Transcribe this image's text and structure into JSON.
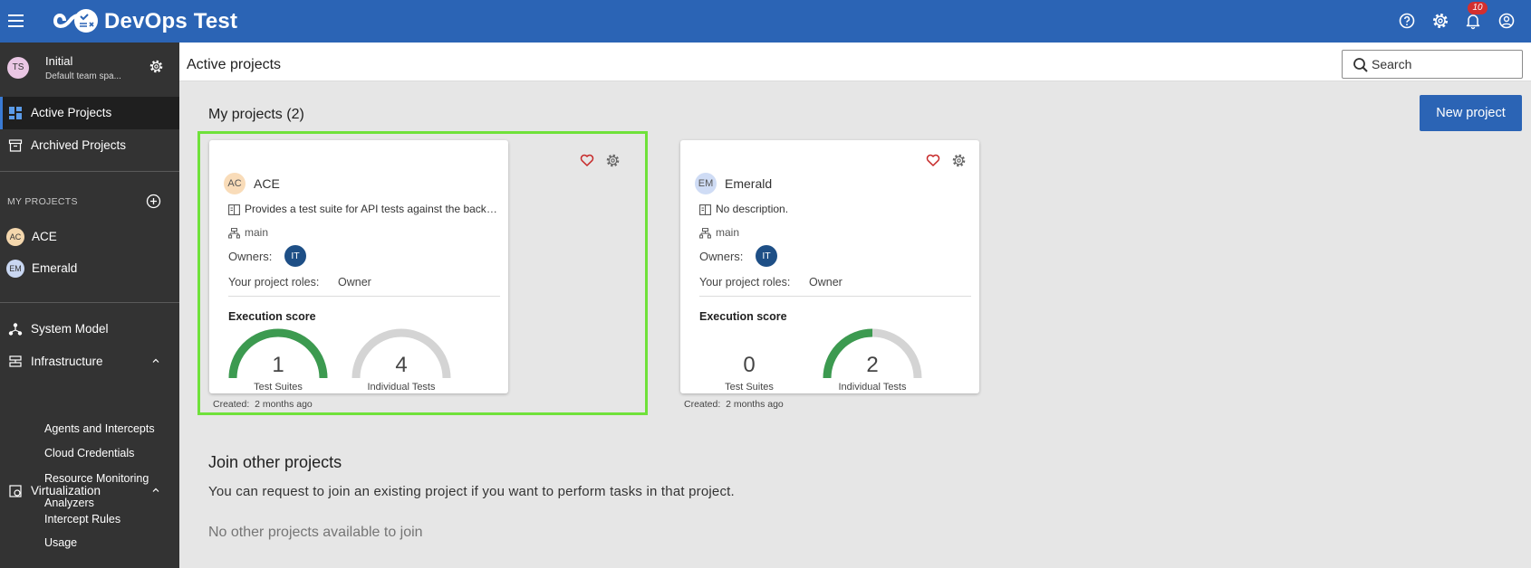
{
  "app": {
    "title": "DevOps Test",
    "notification_count": "10",
    "colors": {
      "topbar": "#2b64b5",
      "sidebar": "#333333",
      "accent_green": "#3c9a50",
      "highlight": "#6fe13a"
    }
  },
  "team": {
    "initials": "TS",
    "name": "Initial",
    "subtitle": "Default team spa..."
  },
  "sidebar": {
    "nav": [
      {
        "label": "Active Projects",
        "icon": "dashboard-icon",
        "active": true
      },
      {
        "label": "Archived Projects",
        "icon": "archive-icon",
        "active": false
      }
    ],
    "my_projects_title": "MY PROJECTS",
    "projects": [
      {
        "initials": "AC",
        "label": "ACE"
      },
      {
        "initials": "EM",
        "label": "Emerald"
      }
    ],
    "system_model": "System Model",
    "infrastructure": {
      "label": "Infrastructure",
      "items": [
        "Agents and Intercepts",
        "Cloud Credentials",
        "Resource Monitoring",
        "Analyzers"
      ]
    },
    "virtualization": {
      "label": "Virtualization",
      "items": [
        "Intercept Rules",
        "Usage"
      ]
    }
  },
  "header": {
    "title": "Active projects",
    "search_placeholder": "Search"
  },
  "main": {
    "my_projects_title": "My projects (2)",
    "new_project_label": "New project",
    "cards": [
      {
        "initials": "AC",
        "name": "ACE",
        "description": "Provides a test suite for API tests against the backend logic of a ACE brokerage system.",
        "branch": "main",
        "owners_label": "Owners:",
        "owner_initials": "IT",
        "roles_label": "Your project roles:",
        "role": "Owner",
        "exec_label": "Execution score",
        "suites": {
          "value": "1",
          "label": "Test Suites",
          "score": 1.0
        },
        "tests": {
          "value": "4",
          "label": "Individual Tests",
          "score": 0.0
        },
        "created_label": "Created:",
        "created": "2 months ago"
      },
      {
        "initials": "EM",
        "name": "Emerald",
        "description": "No description.",
        "branch": "main",
        "owners_label": "Owners:",
        "owner_initials": "IT",
        "roles_label": "Your project roles:",
        "role": "Owner",
        "exec_label": "Execution score",
        "suites": {
          "value": "0",
          "label": "Test Suites",
          "score": null
        },
        "tests": {
          "value": "2",
          "label": "Individual Tests",
          "score": 0.5
        },
        "created_label": "Created:",
        "created": "2 months ago"
      }
    ],
    "join_title": "Join other projects",
    "join_text": "You can request to join an existing project if you want to perform tasks in that project.",
    "no_other": "No other projects available to join"
  }
}
